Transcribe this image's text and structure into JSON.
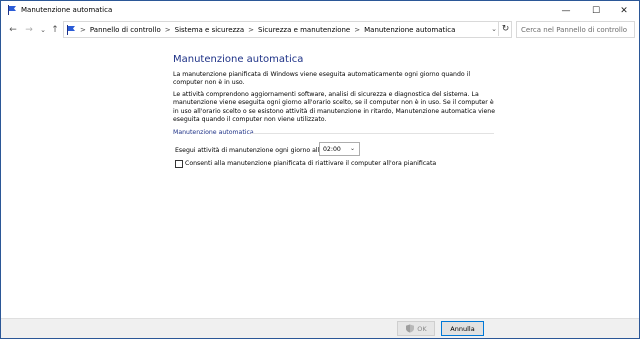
{
  "window": {
    "title": "Manutenzione automatica",
    "controls": {
      "minimize": "—",
      "maximize": "☐",
      "close": "✕"
    }
  },
  "nav": {
    "back": "←",
    "forward": "→",
    "recent": "⌄",
    "up": "↑",
    "breadcrumbs": [
      "Pannello di controllo",
      "Sistema e sicurezza",
      "Sicurezza e manutenzione",
      "Manutenzione automatica"
    ],
    "separator": ">",
    "dropdown": "⌄",
    "refresh": "↻",
    "search_placeholder": "Cerca nel Pannello di controllo"
  },
  "content": {
    "heading": "Manutenzione automatica",
    "para1": "La manutenzione pianificata di Windows viene eseguita automaticamente ogni giorno quando il computer non è in uso.",
    "para2": "Le attività comprendono aggiornamenti software, analisi di sicurezza e diagnostica del sistema. La manutenzione viene eseguita ogni giorno all'orario scelto, se il computer non è in uso. Se il computer è in uso all'orario scelto o se esistono attività di manutenzione in ritardo, Manutenzione automatica viene eseguita quando il computer non viene utilizzato.",
    "group_title": "Manutenzione automatica",
    "time_label": "Esegui attività di manutenzione ogni giorno alle",
    "time_value": "02:00",
    "select_arrow": "⌄",
    "wake_label": "Consenti alla manutenzione pianificata di riattivare il computer all'ora pianificata",
    "wake_checked": false
  },
  "footer": {
    "ok_label": "OK",
    "cancel_label": "Annulla"
  },
  "colors": {
    "heading": "#1e3287",
    "accent_border": "#0078d7"
  }
}
